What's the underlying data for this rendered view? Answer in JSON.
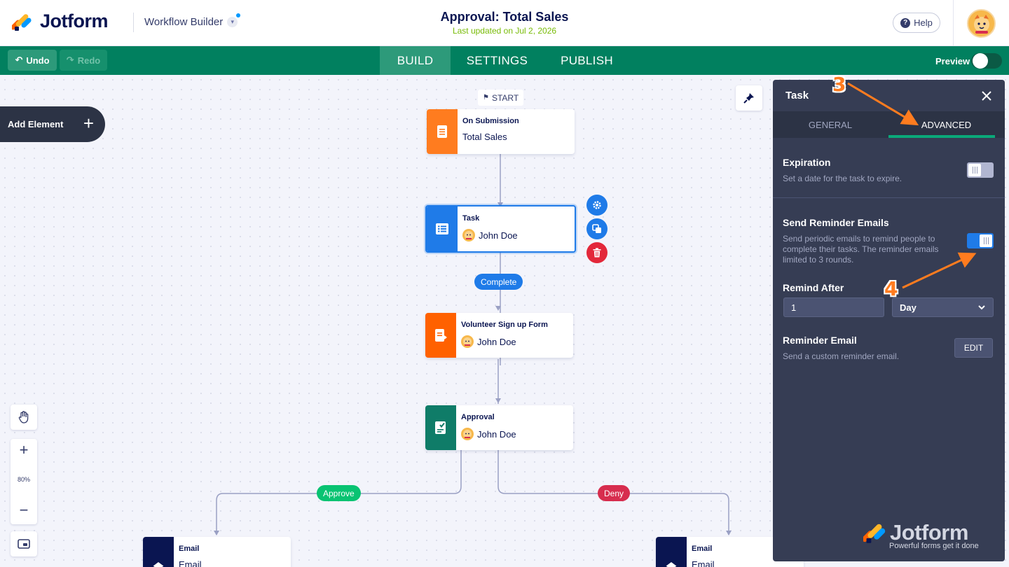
{
  "header": {
    "logo_text": "Jotform",
    "builder_name": "Workflow Builder",
    "title": "Approval: Total Sales",
    "updated": "Last updated on Jul 2, 2026",
    "help_label": "Help"
  },
  "navbar": {
    "undo_label": "Undo",
    "redo_label": "Redo",
    "tabs": [
      {
        "label": "BUILD",
        "active": true
      },
      {
        "label": "SETTINGS",
        "active": false
      },
      {
        "label": "PUBLISH",
        "active": false
      }
    ],
    "preview_label": "Preview",
    "preview_on": false
  },
  "canvas": {
    "add_element_label": "Add Element",
    "start_label": "START",
    "zoom_level": "80%",
    "nodes": [
      {
        "title": "On Submission",
        "subtitle": "Total Sales",
        "color": "#ff7c1f",
        "icon": "form-icon"
      },
      {
        "title": "Task",
        "subtitle": "John Doe",
        "color": "#1f7be8",
        "icon": "task-list-icon",
        "selected": true
      },
      {
        "title": "Volunteer Sign up Form",
        "subtitle": "John Doe",
        "color": "#ff6100",
        "icon": "form-assign-icon"
      },
      {
        "title": "Approval",
        "subtitle": "John Doe",
        "color": "#0f7c68",
        "icon": "approval-icon"
      },
      {
        "title": "Email",
        "subtitle": "Email",
        "color": "#0a1551",
        "icon": "email-icon"
      },
      {
        "title": "Email",
        "subtitle": "Email",
        "color": "#0a1551",
        "icon": "email-icon"
      }
    ],
    "connectors": {
      "complete": "Complete",
      "approve": "Approve",
      "deny": "Deny"
    },
    "colors": {
      "complete": "#1f7be8",
      "approve": "#09c372",
      "deny": "#d72d4e"
    }
  },
  "panel": {
    "title": "Task",
    "tabs": [
      {
        "label": "GENERAL",
        "active": false
      },
      {
        "label": "ADVANCED",
        "active": true
      }
    ],
    "expiration": {
      "title": "Expiration",
      "description": "Set a date for the task to expire.",
      "enabled": false
    },
    "reminder": {
      "title": "Send Reminder Emails",
      "description_line1": "Send periodic emails to remind people to",
      "description_line2": "complete their tasks. The reminder emails",
      "description_line3": "limited to 3 rounds.",
      "enabled": true
    },
    "remind_after": {
      "title": "Remind After",
      "value": "1",
      "unit": "Day"
    },
    "reminder_email": {
      "title": "Reminder Email",
      "description": "Send a custom reminder email.",
      "button_label": "EDIT"
    }
  },
  "watermark": {
    "brand": "Jotform",
    "tagline": "Powerful forms get it done"
  },
  "annotations": {
    "step3": "3",
    "step4": "4",
    "color": "#ff7c1f"
  }
}
